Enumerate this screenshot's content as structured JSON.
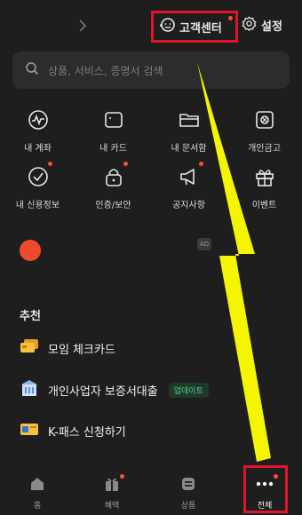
{
  "header": {
    "customer_center_label": "고객센터",
    "settings_label": "설정"
  },
  "search": {
    "placeholder": "상품, 서비스, 증명서 검색"
  },
  "menu": {
    "items": [
      {
        "label": "내 계좌",
        "icon": "account-chart-icon"
      },
      {
        "label": "내 카드",
        "icon": "card-icon"
      },
      {
        "label": "내 문서함",
        "icon": "folder-icon"
      },
      {
        "label": "개인금고",
        "icon": "safe-icon"
      },
      {
        "label": "내 신용정보",
        "icon": "credit-check-icon"
      },
      {
        "label": "인증/보안",
        "icon": "lock-icon"
      },
      {
        "label": "공지사항",
        "icon": "megaphone-icon"
      },
      {
        "label": "이벤트",
        "icon": "gift-icon"
      }
    ]
  },
  "ad": {
    "badge": "AD"
  },
  "recommend": {
    "title": "추천",
    "items": [
      {
        "label": "모임 체크카드",
        "icon": "card-stack-icon"
      },
      {
        "label": "개인사업자 보증서대출",
        "icon": "building-icon",
        "badge": "업데이트"
      },
      {
        "label": "K-패스 신청하기",
        "icon": "kpass-card-icon"
      }
    ]
  },
  "bottom_nav": {
    "items": [
      {
        "label": "홈",
        "icon": "home-icon"
      },
      {
        "label": "혜택",
        "icon": "benefit-gift-icon"
      },
      {
        "label": "상품",
        "icon": "products-icon"
      },
      {
        "label": "전체",
        "icon": "more-dots-icon"
      }
    ]
  },
  "colors": {
    "background": "#1e1e1e",
    "accent_red": "#ff4b3a",
    "highlight_box": "#e0142c",
    "arrow_yellow": "#f5f500",
    "update_green": "#53d38a"
  }
}
